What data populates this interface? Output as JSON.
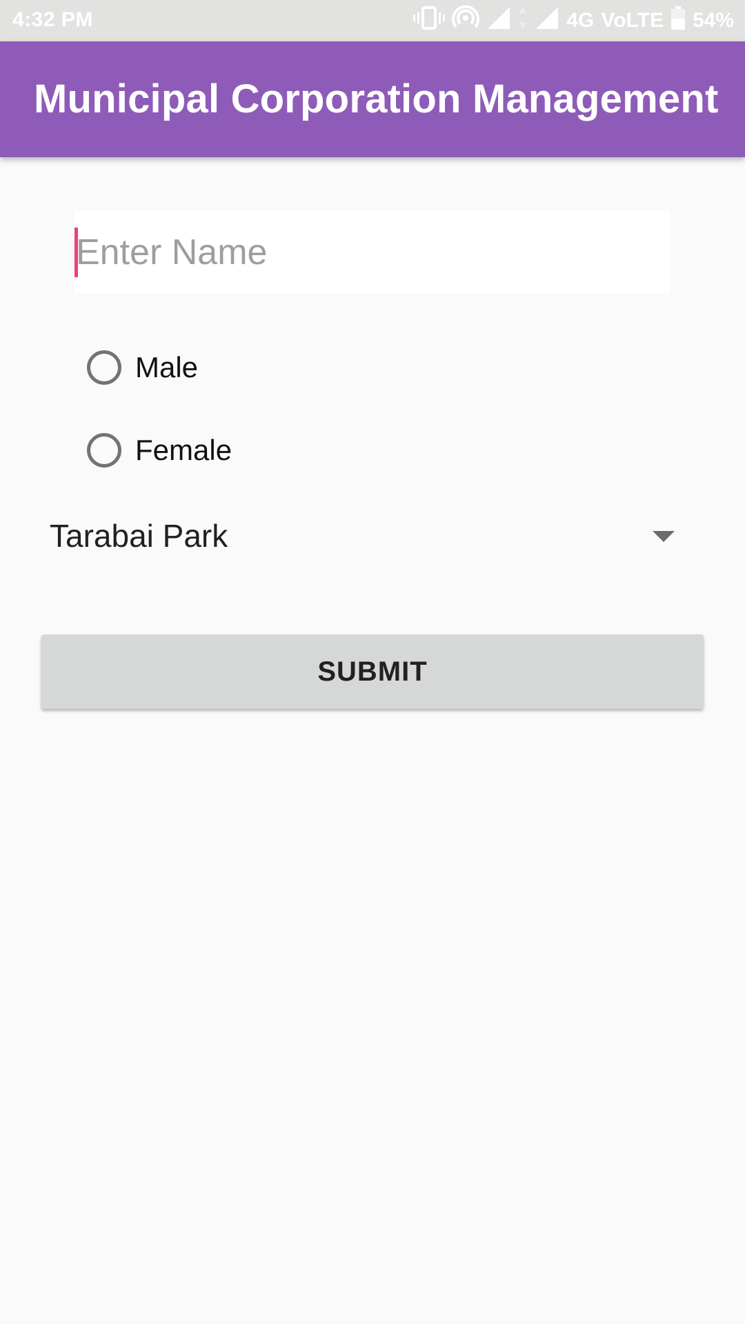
{
  "status_bar": {
    "time": "4:32 PM",
    "network_type": "4G",
    "volte": "VoLTE",
    "battery": "54%",
    "icons": [
      "vibrate-icon",
      "hotspot-icon",
      "signal-icon",
      "data-arrows-icon",
      "signal-icon",
      "battery-icon"
    ]
  },
  "app_bar": {
    "title": "Municipal Corporation Management",
    "color": "#8e5cb8"
  },
  "form": {
    "name_input": {
      "placeholder": "Enter Name",
      "value": ""
    },
    "gender_options": [
      {
        "label": "Male",
        "selected": false
      },
      {
        "label": "Female",
        "selected": false
      }
    ],
    "area_spinner": {
      "selected": "Tarabai Park"
    },
    "submit_label": "SUBMIT"
  },
  "colors": {
    "accent_cursor": "#ec407a",
    "background": "#fafafa",
    "button_bg": "#d6d7d7"
  }
}
